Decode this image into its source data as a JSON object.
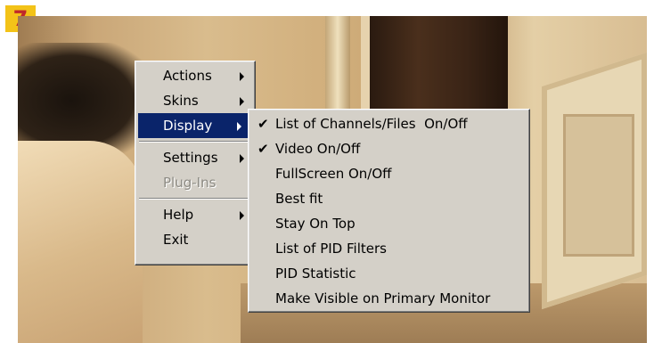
{
  "badge": {
    "label": "7"
  },
  "main_menu": {
    "items": [
      {
        "label": "Actions"
      },
      {
        "label": "Skins"
      },
      {
        "label": "Display"
      },
      {
        "label": "Settings"
      },
      {
        "label": "Plug-Ins"
      },
      {
        "label": "Help"
      },
      {
        "label": "Exit"
      }
    ]
  },
  "display_submenu": {
    "check_glyph": "✔",
    "items": [
      {
        "label": "List of Channels/Files  On/Off",
        "checked": true
      },
      {
        "label": "Video On/Off",
        "checked": true
      },
      {
        "label": "FullScreen On/Off",
        "checked": false
      },
      {
        "label": "Best fit",
        "checked": false
      },
      {
        "label": "Stay On Top",
        "checked": false
      },
      {
        "label": "List of PID Filters",
        "checked": false
      },
      {
        "label": "PID Statistic",
        "checked": false
      },
      {
        "label": "Make Visible on Primary Monitor",
        "checked": false
      }
    ]
  },
  "colors": {
    "menu_bg": "#d4d0c8",
    "highlight": "#0a246a",
    "badge_bg": "#f3c318",
    "badge_text": "#c0282a"
  }
}
